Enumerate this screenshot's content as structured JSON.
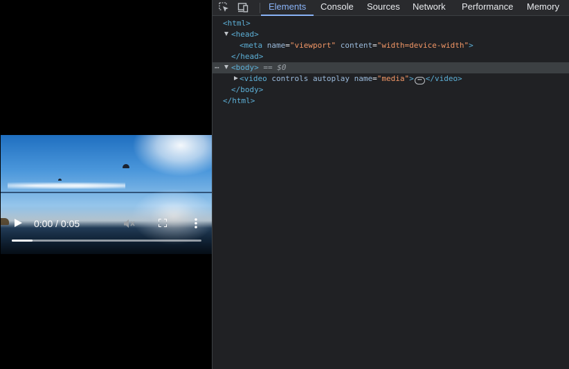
{
  "video": {
    "time_display": "0:00 / 0:05",
    "progress": 0.11
  },
  "devtools": {
    "tabs": [
      {
        "label": "Elements",
        "active": true
      },
      {
        "label": "Console"
      },
      {
        "label": "Sources"
      },
      {
        "label": "Network"
      },
      {
        "label": "Performance"
      },
      {
        "label": "Memory"
      }
    ],
    "tree": {
      "html_open": "<html>",
      "head_open": "<head>",
      "meta": {
        "open": "<meta",
        "attr1_name": "name",
        "attr1_val": "\"viewport\"",
        "attr2_name": "content",
        "attr2_val": "\"width=device-width\"",
        "close": ">"
      },
      "head_close": "</head>",
      "body_open": "<body>",
      "body_marker": "== $0",
      "video": {
        "open": "<video",
        "attr1_name": "controls",
        "attr2_name": "autoplay",
        "attr3_name": "name",
        "attr3_val": "\"media\"",
        "mid": ">",
        "pill": "⋯",
        "close": "</video>"
      },
      "body_close": "</body>",
      "html_close": "</html>",
      "row_menu": "⋯"
    }
  },
  "colors": {
    "devtools_bg": "#202124",
    "accent": "#8ab4f8",
    "tag": "#5db0d7",
    "attr_value": "#f29766"
  }
}
